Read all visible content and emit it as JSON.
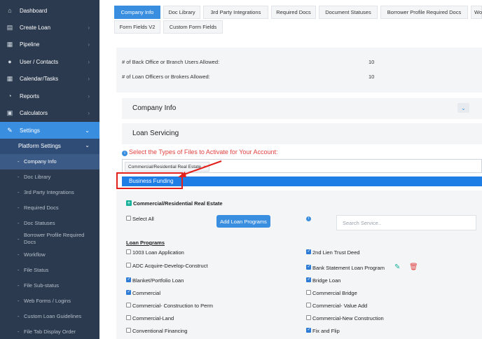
{
  "sidebar": {
    "items": [
      {
        "label": "Dashboard",
        "icon": "home-icon"
      },
      {
        "label": "Create Loan",
        "icon": "document-icon"
      },
      {
        "label": "Pipeline",
        "icon": "pipeline-icon"
      },
      {
        "label": "User / Contacts",
        "icon": "user-icon"
      },
      {
        "label": "Calendar/Tasks",
        "icon": "calendar-icon"
      },
      {
        "label": "Reports",
        "icon": "reports-icon"
      },
      {
        "label": "Calculators",
        "icon": "calculator-icon"
      },
      {
        "label": "Settings",
        "icon": "wrench-icon"
      }
    ],
    "platform_settings": "Platform Settings",
    "sub_items": [
      "Company Info",
      "Doc Library",
      "3rd Party Integrations",
      "Required Docs",
      "Doc Statuses",
      "Borrower Profile Required Docs",
      "Workflow",
      "File Status",
      "File Sub-status",
      "Web Forms / Logins",
      "Custom Loan Guidelines",
      "File Tab Display Order"
    ]
  },
  "tabs": [
    "Company Info",
    "Doc Library",
    "3rd Party Integrations",
    "Required Docs",
    "Document Statuses",
    "Borrower Profile Required Docs",
    "Wo",
    "Form Fields V2",
    "Custom Form Fields"
  ],
  "limits": {
    "back_office_label": "# of Back Office or Branch Users Allowed:",
    "back_office_value": "10",
    "officers_label": "# of Loan Officers or Brokers Allowed:",
    "officers_value": "10"
  },
  "panels": {
    "company_info": "Company Info",
    "loan_servicing": "Loan Servicing"
  },
  "file_types": {
    "title": "Select the Types of Files to Activate for Your Account:",
    "selected_tag": "Commercial/Residential Real Estate",
    "tag_remove": "×",
    "dropdown_option": "Business Funding"
  },
  "programs": {
    "section_title": "Commercial/Residential Real Estate",
    "select_all": "Select All",
    "add_button": "Add Loan Programs",
    "search_placeholder": "Search Service..",
    "heading": "Loan Programs",
    "left": [
      {
        "label": "1003 Loan Application",
        "checked": false
      },
      {
        "label": "ADC Acquire-Develop-Construct",
        "checked": false
      },
      {
        "label": "Blanket/Portfolio Loan",
        "checked": true
      },
      {
        "label": "Commercial",
        "checked": true
      },
      {
        "label": "Commercial- Construction to Perm",
        "checked": false
      },
      {
        "label": "Commercial-Land",
        "checked": false
      },
      {
        "label": "Conventional Financing",
        "checked": false
      }
    ],
    "right": [
      {
        "label": "2nd Lien Trust Deed",
        "checked": true
      },
      {
        "label": "Bank Statement Loan Program",
        "checked": true
      },
      {
        "label": "Bridge Loan",
        "checked": true
      },
      {
        "label": "Commercial Bridge",
        "checked": false
      },
      {
        "label": "Commercial- Value Add",
        "checked": false
      },
      {
        "label": "Commercial-New Construction",
        "checked": false
      },
      {
        "label": "Fix and Flip",
        "checked": true
      }
    ]
  },
  "colors": {
    "sidebar_bg": "#2b3a4e",
    "accent": "#3a8ee0",
    "dropdown_highlight": "#1f7de6",
    "alert_red": "#e0413f",
    "annotation_red": "#e2201c"
  }
}
